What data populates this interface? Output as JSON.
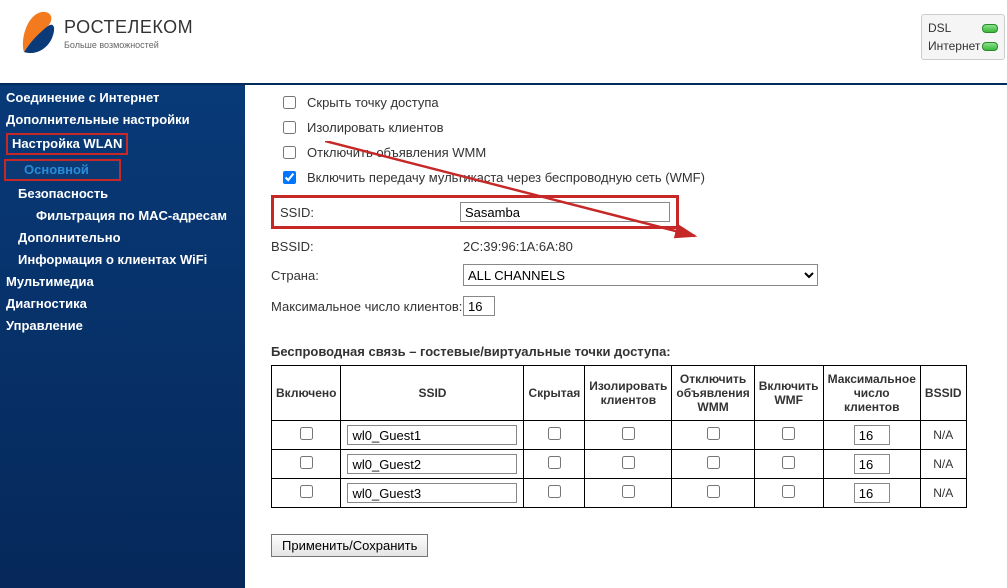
{
  "header": {
    "logo_title": "РОСТЕЛЕКОМ",
    "logo_sub": "Больше возможностей",
    "status": {
      "dsl": "DSL",
      "internet": "Интернет"
    }
  },
  "sidebar": {
    "items": [
      {
        "label": "Соединение с Интернет"
      },
      {
        "label": "Дополнительные настройки"
      },
      {
        "label": "Настройка WLAN"
      },
      {
        "label": "Основной"
      },
      {
        "label": "Безопасность"
      },
      {
        "label": "Фильтрация по MAC-адресам"
      },
      {
        "label": "Дополнительно"
      },
      {
        "label": "Информация о клиентах WiFi"
      },
      {
        "label": "Мультимедиа"
      },
      {
        "label": "Диагностика"
      },
      {
        "label": "Управление"
      }
    ]
  },
  "options": {
    "hide_ap": "Скрыть точку доступа",
    "isolate": "Изолировать клиентов",
    "wmm_off": "Отключить объявления WMM",
    "wmf_on": "Включить передачу мультикаста через беспроводную сеть (WMF)"
  },
  "fields": {
    "ssid_label": "SSID:",
    "ssid_value": "Sasamba",
    "bssid_label": "BSSID:",
    "bssid_value": "2C:39:96:1A:6A:80",
    "country_label": "Страна:",
    "country_value": "ALL CHANNELS",
    "maxclients_label": "Максимальное число клиентов:",
    "maxclients_value": "16"
  },
  "guest": {
    "title": "Беспроводная связь – гостевые/виртуальные точки доступа:",
    "headers": {
      "enabled": "Включено",
      "ssid": "SSID",
      "hidden": "Скрытая",
      "isolate": "Изолировать клиентов",
      "wmm_off": "Отключить объявления WMM",
      "wmf": "Включить WMF",
      "max": "Максимальное число клиентов",
      "bssid": "BSSID"
    },
    "rows": [
      {
        "ssid": "wl0_Guest1",
        "max": "16",
        "bssid": "N/A"
      },
      {
        "ssid": "wl0_Guest2",
        "max": "16",
        "bssid": "N/A"
      },
      {
        "ssid": "wl0_Guest3",
        "max": "16",
        "bssid": "N/A"
      }
    ]
  },
  "buttons": {
    "apply": "Применить/Сохранить"
  }
}
